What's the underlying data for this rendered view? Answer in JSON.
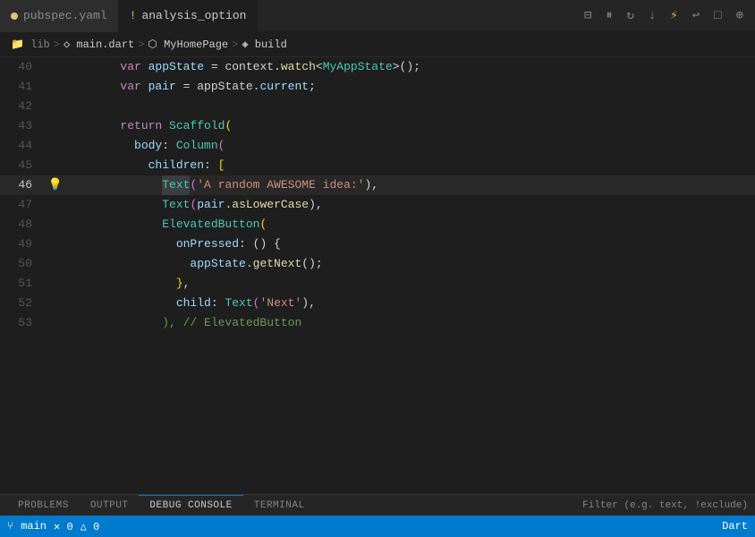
{
  "tabs": [
    {
      "id": "pubspec",
      "label": "pubspec.yaml",
      "state": "modified",
      "active": false
    },
    {
      "id": "analysis",
      "label": "analysis_option",
      "state": "warning",
      "active": true
    }
  ],
  "tab_actions": [
    "split",
    "pause",
    "replay",
    "step-back",
    "lightning",
    "undo",
    "stop",
    "search"
  ],
  "breadcrumb": [
    {
      "text": "lib",
      "icon": "folder",
      "dim": true
    },
    {
      "text": "main.dart",
      "icon": "file"
    },
    {
      "text": "MyHomePage",
      "icon": "class"
    },
    {
      "text": "build",
      "icon": "method"
    }
  ],
  "code": {
    "lines": [
      {
        "num": "40",
        "active": false,
        "gutter": false,
        "tokens": [
          {
            "text": "        var ",
            "cls": "kw"
          },
          {
            "text": "appState",
            "cls": "var-name"
          },
          {
            "text": " = context.",
            "cls": "punct"
          },
          {
            "text": "watch",
            "cls": "method"
          },
          {
            "text": "<",
            "cls": "punct"
          },
          {
            "text": "MyAppState",
            "cls": "type-cls"
          },
          {
            "text": ">()",
            "cls": "punct"
          },
          {
            "text": ";",
            "cls": "punct"
          }
        ]
      },
      {
        "num": "41",
        "active": false,
        "gutter": false,
        "tokens": [
          {
            "text": "        var ",
            "cls": "kw"
          },
          {
            "text": "pair",
            "cls": "var-name"
          },
          {
            "text": " = appState.",
            "cls": "punct"
          },
          {
            "text": "current",
            "cls": "prop"
          },
          {
            "text": ";",
            "cls": "punct"
          }
        ]
      },
      {
        "num": "42",
        "active": false,
        "gutter": false,
        "tokens": []
      },
      {
        "num": "43",
        "active": false,
        "gutter": false,
        "tokens": [
          {
            "text": "        return ",
            "cls": "kw"
          },
          {
            "text": "Scaffold",
            "cls": "type-cls"
          },
          {
            "text": "(",
            "cls": "bracket-yellow"
          }
        ]
      },
      {
        "num": "44",
        "active": false,
        "gutter": false,
        "tokens": [
          {
            "text": "          body",
            "cls": "prop"
          },
          {
            "text": ": ",
            "cls": "punct"
          },
          {
            "text": "Column",
            "cls": "type-cls"
          },
          {
            "text": "(",
            "cls": "bracket-orange"
          }
        ]
      },
      {
        "num": "45",
        "active": false,
        "gutter": false,
        "tokens": [
          {
            "text": "            children",
            "cls": "prop"
          },
          {
            "text": ": ",
            "cls": "punct"
          },
          {
            "text": "[",
            "cls": "bracket-yellow"
          }
        ]
      },
      {
        "num": "46",
        "active": true,
        "gutter": true,
        "tokens": [
          {
            "text": "              ",
            "cls": "punct"
          },
          {
            "text": "Text",
            "cls": "type-cls",
            "highlight": true
          },
          {
            "text": "(",
            "cls": "bracket-orange"
          },
          {
            "text": "'A random AWESOME idea:'",
            "cls": "str"
          },
          {
            "text": "),",
            "cls": "punct"
          }
        ]
      },
      {
        "num": "47",
        "active": false,
        "gutter": false,
        "tokens": [
          {
            "text": "              ",
            "cls": "punct"
          },
          {
            "text": "Text",
            "cls": "type-cls"
          },
          {
            "text": "(",
            "cls": "bracket-orange"
          },
          {
            "text": "pair",
            "cls": "var-name"
          },
          {
            "text": ".",
            "cls": "punct"
          },
          {
            "text": "asLowerCase",
            "cls": "method"
          },
          {
            "text": "),",
            "cls": "punct"
          }
        ]
      },
      {
        "num": "48",
        "active": false,
        "gutter": false,
        "tokens": [
          {
            "text": "              ",
            "cls": "punct"
          },
          {
            "text": "ElevatedButton",
            "cls": "type-cls"
          },
          {
            "text": "(",
            "cls": "bracket-yellow"
          }
        ]
      },
      {
        "num": "49",
        "active": false,
        "gutter": false,
        "tokens": [
          {
            "text": "                onPressed",
            "cls": "prop"
          },
          {
            "text": ": () {",
            "cls": "punct"
          }
        ]
      },
      {
        "num": "50",
        "active": false,
        "gutter": false,
        "tokens": [
          {
            "text": "                  appState",
            "cls": "var-name"
          },
          {
            "text": ".",
            "cls": "punct"
          },
          {
            "text": "getNext",
            "cls": "method"
          },
          {
            "text": "();",
            "cls": "punct"
          }
        ]
      },
      {
        "num": "51",
        "active": false,
        "gutter": false,
        "tokens": [
          {
            "text": "                ",
            "cls": "punct"
          },
          {
            "text": "}",
            "cls": "bracket-yellow"
          },
          {
            "text": ",",
            "cls": "punct"
          }
        ]
      },
      {
        "num": "52",
        "active": false,
        "gutter": false,
        "tokens": [
          {
            "text": "                child",
            "cls": "prop"
          },
          {
            "text": ": ",
            "cls": "punct"
          },
          {
            "text": "Text",
            "cls": "type-cls"
          },
          {
            "text": "(",
            "cls": "bracket-orange"
          },
          {
            "text": "'Next'",
            "cls": "str"
          },
          {
            "text": "),",
            "cls": "punct"
          }
        ]
      },
      {
        "num": "53",
        "active": false,
        "gutter": false,
        "tokens": [
          {
            "text": "              ",
            "cls": "punct"
          },
          {
            "text": "), // ElevatedButton",
            "cls": "comment"
          }
        ]
      }
    ]
  },
  "panel": {
    "tabs": [
      "PROBLEMS",
      "OUTPUT",
      "DEBUG CONSOLE",
      "TERMINAL"
    ],
    "active_tab": "DEBUG CONSOLE",
    "filter_placeholder": "Filter (e.g. text, !exclude)"
  },
  "status_bar": {
    "branch": "main",
    "errors": "0",
    "warnings": "0",
    "info": "Dart"
  }
}
